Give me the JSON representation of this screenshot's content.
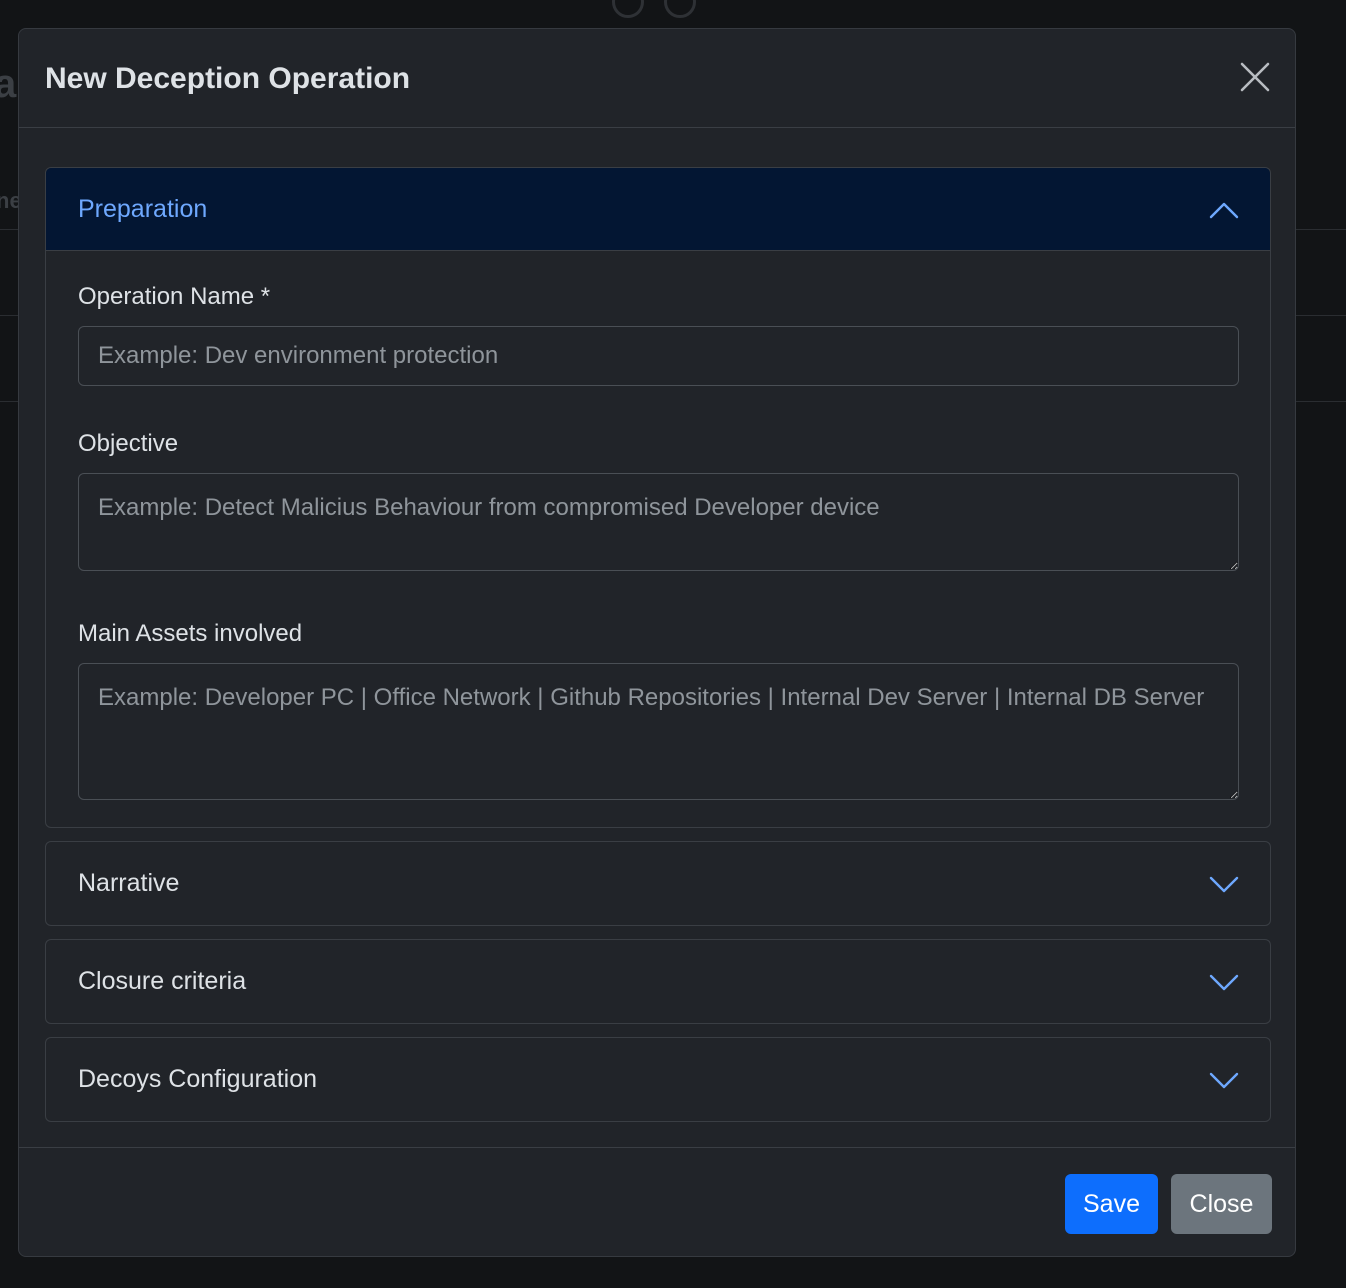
{
  "background": {
    "title_fragment": "a",
    "tab_fragment": "ne"
  },
  "modal": {
    "title": "New Deception Operation",
    "close_icon": "close-x-icon"
  },
  "accordion": {
    "preparation": {
      "header": "Preparation",
      "expanded": true,
      "fields": {
        "operation_name": {
          "label": "Operation Name *",
          "value": "",
          "placeholder": "Example: Dev environment protection"
        },
        "objective": {
          "label": "Objective",
          "value": "",
          "placeholder": "Example: Detect Malicius Behaviour from compromised Developer device"
        },
        "main_assets": {
          "label": "Main Assets involved",
          "value": "",
          "placeholder": "Example: Developer PC | Office Network | Github Repositories | Internal Dev Server | Internal DB Server"
        }
      }
    },
    "narrative": {
      "header": "Narrative",
      "expanded": false
    },
    "closure_criteria": {
      "header": "Closure criteria",
      "expanded": false
    },
    "decoys_configuration": {
      "header": "Decoys Configuration",
      "expanded": false
    }
  },
  "footer": {
    "save_label": "Save",
    "close_label": "Close"
  },
  "colors": {
    "accent": "#0d6efd",
    "secondary": "#6c757d",
    "accordion_active_bg": "#031633",
    "accordion_active_text": "#6ea8fe",
    "modal_bg": "#212429"
  }
}
